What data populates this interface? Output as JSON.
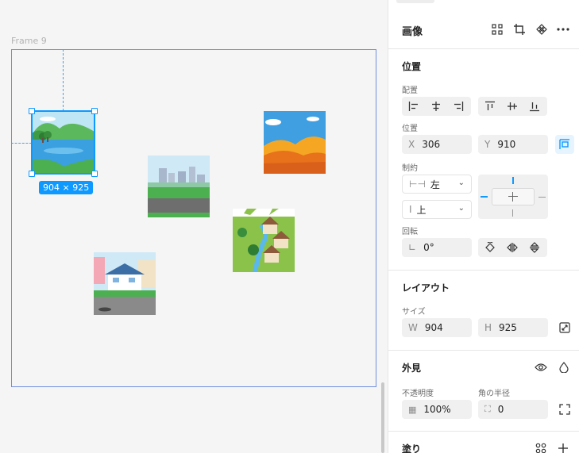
{
  "canvas": {
    "frame_label": "Frame 9",
    "selection_size": "904 × 925"
  },
  "panel": {
    "header": {
      "title": "画像"
    },
    "position": {
      "title": "位置",
      "align_label": "配置",
      "position_label": "位置",
      "x_prefix": "X",
      "x_value": "306",
      "y_prefix": "Y",
      "y_value": "910",
      "constraints_label": "制約",
      "horizontal_constraint": "左",
      "vertical_constraint": "上",
      "rotation_label": "回転",
      "rotation_value": "0°"
    },
    "layout": {
      "title": "レイアウト",
      "size_label": "サイズ",
      "w_prefix": "W",
      "w_value": "904",
      "h_prefix": "H",
      "h_value": "925"
    },
    "appearance": {
      "title": "外見",
      "opacity_label": "不透明度",
      "opacity_value": "100%",
      "radius_label": "角の半径",
      "radius_value": "0"
    },
    "fill": {
      "title": "塗り"
    }
  },
  "colors": {
    "accent": "#0d99ff",
    "frame_border": "#6f8fdc"
  }
}
